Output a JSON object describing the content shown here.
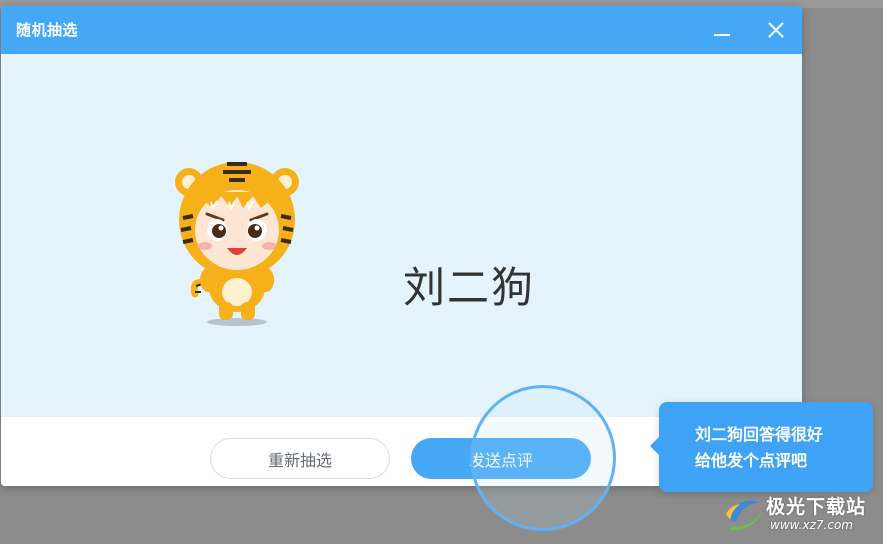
{
  "window": {
    "title": "随机抽选",
    "minimize_icon": "minimize-icon",
    "close_icon": "close-icon"
  },
  "selection": {
    "student_name": "刘二狗",
    "mascot": "tiger-mascot"
  },
  "footer": {
    "redraw_label": "重新抽选",
    "comment_label": "发送点评"
  },
  "tooltip": {
    "line1": "刘二狗回答得很好",
    "line2": "给他发个点评吧"
  },
  "watermark": {
    "title": "极光下载站",
    "url": "www.xz7.com"
  },
  "colors": {
    "accent": "#45a8f7",
    "content_bg": "#e5f4fc",
    "overlay_bg": "#8c8c8c"
  }
}
